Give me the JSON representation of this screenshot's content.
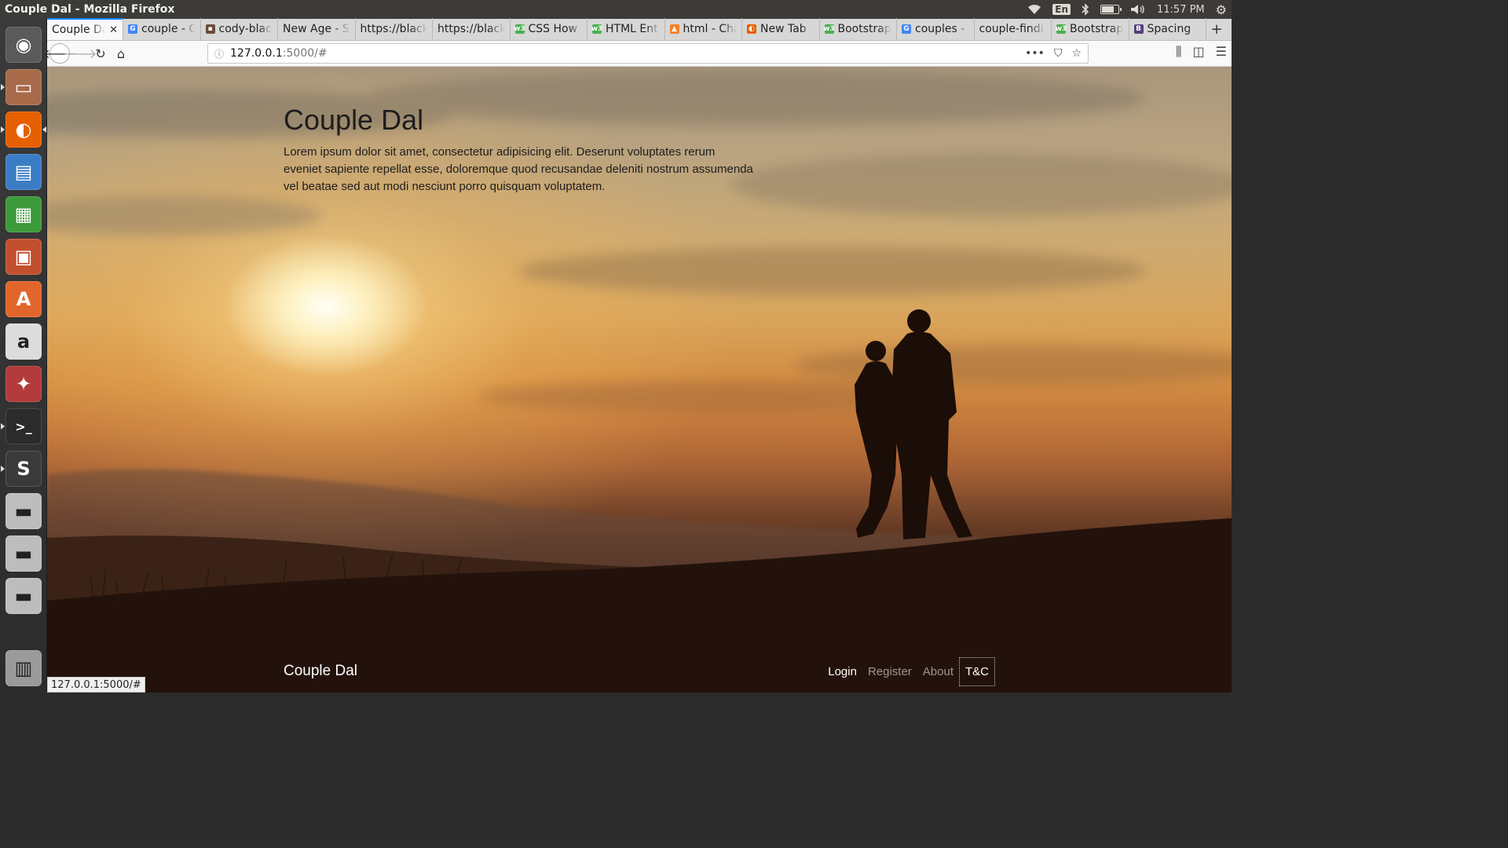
{
  "window": {
    "title": "Couple Dal - Mozilla Firefox"
  },
  "system": {
    "language": "En",
    "time": "11:57 PM",
    "battery_level": 0.8
  },
  "launcher": [
    {
      "name": "dash-icon",
      "glyph": "◉",
      "bg": "#5a5a5a"
    },
    {
      "name": "files-icon",
      "glyph": "▭",
      "bg": "#a86b4a"
    },
    {
      "name": "firefox-icon",
      "glyph": "◐",
      "bg": "#e66000"
    },
    {
      "name": "writer-icon",
      "glyph": "▤",
      "bg": "#3b7dc4"
    },
    {
      "name": "calc-icon",
      "glyph": "▦",
      "bg": "#3d9a3a"
    },
    {
      "name": "impress-icon",
      "glyph": "▣",
      "bg": "#c2502f"
    },
    {
      "name": "software-center-icon",
      "glyph": "A",
      "bg": "#e2662b"
    },
    {
      "name": "amazon-icon",
      "glyph": "a",
      "bg": "#dcdcdc"
    },
    {
      "name": "system-settings-icon",
      "glyph": "✦",
      "bg": "#b33b3b"
    },
    {
      "name": "terminal-icon",
      "glyph": ">_",
      "bg": "#2b2b2b"
    },
    {
      "name": "sublime-text-icon",
      "glyph": "S",
      "bg": "#3a3a3a"
    },
    {
      "name": "drive-icon-1",
      "glyph": "▬",
      "bg": "#bdbdbd"
    },
    {
      "name": "drive-icon-2",
      "glyph": "▬",
      "bg": "#bdbdbd"
    },
    {
      "name": "drive-icon-3",
      "glyph": "▬",
      "bg": "#bdbdbd"
    },
    {
      "name": "trash-icon",
      "glyph": "▥",
      "bg": "#9a9a9a"
    }
  ],
  "tabs": [
    {
      "label": "Couple Dal",
      "favicon": "",
      "fav_color": "",
      "active": true
    },
    {
      "label": "couple - G",
      "favicon": "G",
      "fav_color": "#4285f4"
    },
    {
      "label": "cody-black",
      "favicon": "▪",
      "fav_color": "#6b4b3a"
    },
    {
      "label": "New Age - S",
      "favicon": "",
      "fav_color": ""
    },
    {
      "label": "https://black",
      "favicon": "",
      "fav_color": ""
    },
    {
      "label": "https://black",
      "favicon": "",
      "fav_color": ""
    },
    {
      "label": "CSS How",
      "favicon": "w3",
      "fav_color": "#4caf50"
    },
    {
      "label": "HTML Ent",
      "favicon": "w3",
      "fav_color": "#4caf50"
    },
    {
      "label": "html - Cha",
      "favicon": "▲",
      "fav_color": "#f48024"
    },
    {
      "label": "New Tab",
      "favicon": "◐",
      "fav_color": "#e66000"
    },
    {
      "label": "Bootstrap",
      "favicon": "w3",
      "fav_color": "#4caf50"
    },
    {
      "label": "couples -",
      "favicon": "G",
      "fav_color": "#4285f4"
    },
    {
      "label": "couple-findi",
      "favicon": "",
      "fav_color": ""
    },
    {
      "label": "Bootstrap",
      "favicon": "w3",
      "fav_color": "#4caf50"
    },
    {
      "label": "Spacing",
      "favicon": "B",
      "fav_color": "#563d7c"
    }
  ],
  "url": {
    "host": "127.0.0.1",
    "path": ":5000/#"
  },
  "page": {
    "title": "Couple Dal",
    "lead": "Lorem ipsum dolor sit amet, consectetur adipisicing elit. Deserunt voluptates rerum eveniet sapiente repellat esse, doloremque quod recusandae deleniti nostrum assumenda vel beatae sed aut modi nesciunt porro quisquam voluptatem.",
    "footer_brand": "Couple Dal",
    "footer_links": [
      {
        "label": "Login",
        "state": "active"
      },
      {
        "label": "Register",
        "state": ""
      },
      {
        "label": "About",
        "state": ""
      },
      {
        "label": "T&C",
        "state": "focused"
      }
    ]
  },
  "status_url": "127.0.0.1:5000/#"
}
